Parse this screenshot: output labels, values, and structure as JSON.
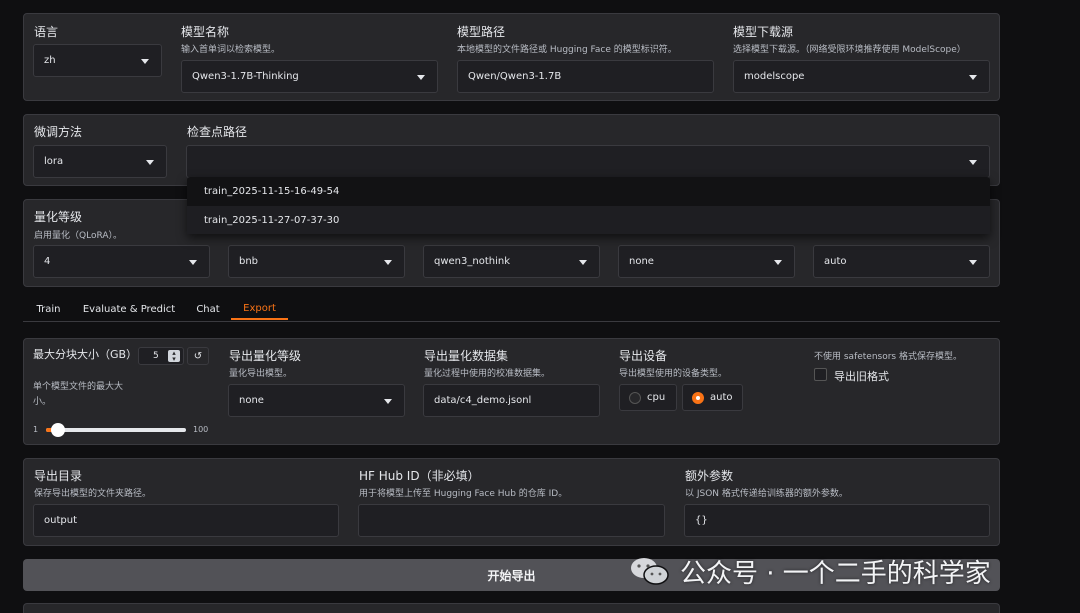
{
  "row1": {
    "language": {
      "label": "语言",
      "value": "zh"
    },
    "model_name": {
      "label": "模型名称",
      "hint": "输入首单词以检索模型。",
      "value": "Qwen3-1.7B-Thinking"
    },
    "model_path": {
      "label": "模型路径",
      "hint": "本地模型的文件路径或 Hugging Face 的模型标识符。",
      "value": "Qwen/Qwen3-1.7B"
    },
    "model_source": {
      "label": "模型下载源",
      "hint": "选择模型下载源。（网络受限环境推荐使用 ModelScope）",
      "value": "modelscope"
    }
  },
  "row2": {
    "finetune": {
      "label": "微调方法",
      "value": "lora"
    },
    "checkpoint": {
      "label": "检查点路径",
      "value": "",
      "options": [
        "train_2025-11-15-16-49-54",
        "train_2025-11-27-07-37-30"
      ]
    }
  },
  "row3": {
    "quant": {
      "label": "量化等级",
      "hint": "启用量化（QLoRA）。",
      "value": "4"
    },
    "quant_method": {
      "value": "bnb"
    },
    "template": {
      "value": "qwen3_nothink"
    },
    "rope": {
      "value": "none"
    },
    "booster": {
      "value": "auto"
    }
  },
  "tabs": [
    "Train",
    "Evaluate & Predict",
    "Chat",
    "Export"
  ],
  "active_tab": "Export",
  "export": {
    "shard": {
      "label": "最大分块大小（GB）",
      "hint": "单个模型文件的最大大小。",
      "value": "5",
      "min": "1",
      "max": "100",
      "reset": "↺",
      "level": 0.04
    },
    "export_quant": {
      "label": "导出量化等级",
      "hint": "量化导出模型。",
      "value": "none"
    },
    "dataset": {
      "label": "导出量化数据集",
      "hint": "量化过程中使用的校准数据集。",
      "value": "data/c4_demo.jsonl"
    },
    "device": {
      "label": "导出设备",
      "hint": "导出模型使用的设备类型。",
      "options": [
        "cpu",
        "auto"
      ],
      "selected": "auto"
    },
    "legacy": {
      "hint": "不使用 safetensors 格式保存模型。",
      "label": "导出旧格式"
    }
  },
  "dirs": {
    "dir": {
      "label": "导出目录",
      "hint": "保存导出模型的文件夹路径。",
      "value": "output"
    },
    "hub": {
      "label": "HF Hub ID（非必填）",
      "hint": "用于将模型上传至 Hugging Face Hub 的仓库 ID。",
      "value": ""
    },
    "extra": {
      "label": "额外参数",
      "hint": "以 JSON 格式传递给训练器的额外参数。",
      "value": "{}"
    }
  },
  "start_button": "开始导出",
  "watermark": "公众号 · 一个二手的科学家",
  "colors": {
    "accent": "#f97316",
    "panel": "#27272a",
    "background": "#0f0f11"
  }
}
